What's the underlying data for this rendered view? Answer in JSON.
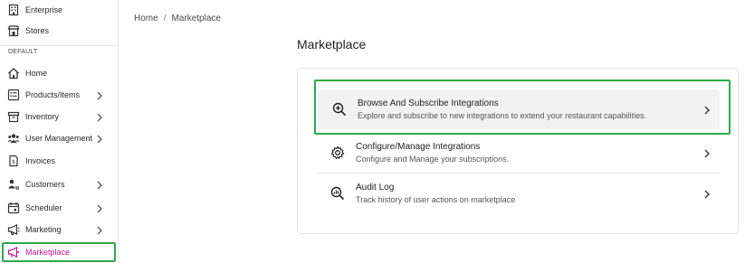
{
  "sidebar": {
    "items_top": [
      {
        "label": "Enterprise",
        "icon": "building-icon"
      },
      {
        "label": "Stores",
        "icon": "store-icon"
      }
    ],
    "section_label": "DEFAULT",
    "items": [
      {
        "label": "Home",
        "icon": "home-icon",
        "has_chevron": false
      },
      {
        "label": "Products/Items",
        "icon": "list-icon",
        "has_chevron": true
      },
      {
        "label": "Inventory",
        "icon": "box-icon",
        "has_chevron": true
      },
      {
        "label": "User Management",
        "icon": "users-icon",
        "has_chevron": true
      },
      {
        "label": "Invoices",
        "icon": "invoice-icon",
        "has_chevron": false
      },
      {
        "label": "Customers",
        "icon": "customer-icon",
        "has_chevron": true
      },
      {
        "label": "Scheduler",
        "icon": "calendar-icon",
        "has_chevron": true
      },
      {
        "label": "Marketing",
        "icon": "megaphone-icon",
        "has_chevron": true
      },
      {
        "label": "Marketplace",
        "icon": "marketplace-icon",
        "has_chevron": false,
        "active": true
      }
    ]
  },
  "breadcrumb": {
    "home": "Home",
    "separator": "/",
    "current": "Marketplace"
  },
  "page": {
    "title": "Marketplace"
  },
  "marketplace": {
    "options": [
      {
        "title": "Browse And Subscribe Integrations",
        "description": "Explore and subscribe to new integrations to extend your restaurant capabilities.",
        "icon": "search-plus-icon"
      },
      {
        "title": "Configure/Manage Integrations",
        "description": "Configure and Manage your subscriptions.",
        "icon": "gear-icon"
      },
      {
        "title": "Audit Log",
        "description": "Track history of user actions on marketplace",
        "icon": "audit-chart-icon"
      }
    ]
  },
  "colors": {
    "active": "#c4169a",
    "highlight": "#2fa94a",
    "row_hover": "#f2f2f2"
  }
}
